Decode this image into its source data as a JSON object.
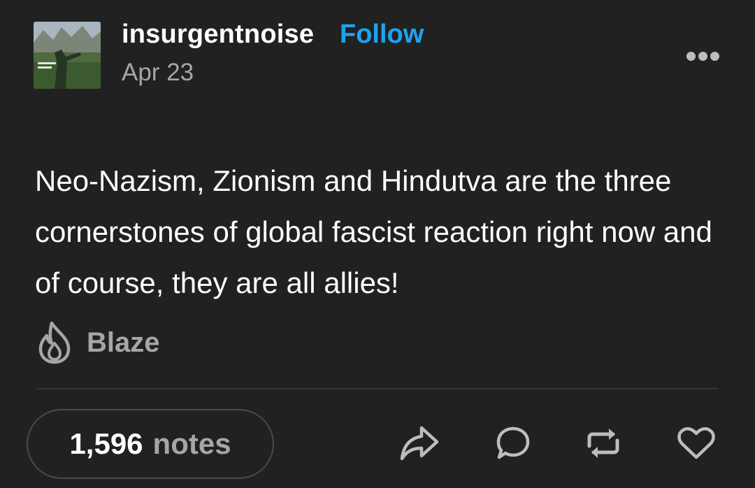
{
  "post": {
    "username": "insurgentnoise",
    "follow_label": "Follow",
    "date": "Apr 23",
    "text": "Neo-Nazism, Zionism and Hindutva are the three cornerstones of global fascist reaction right now and of course, they are all allies!",
    "blaze_label": "Blaze",
    "notes_count": "1,596",
    "notes_label": "notes"
  },
  "icons": {
    "more": "more-horizontal-icon",
    "blaze": "flame-icon",
    "share": "share-arrow-icon",
    "reply": "speech-bubble-icon",
    "reblog": "reblog-icon",
    "like": "heart-icon"
  },
  "colors": {
    "background": "#212121",
    "accent": "#1ea2ee",
    "muted": "#a6a6a6"
  }
}
